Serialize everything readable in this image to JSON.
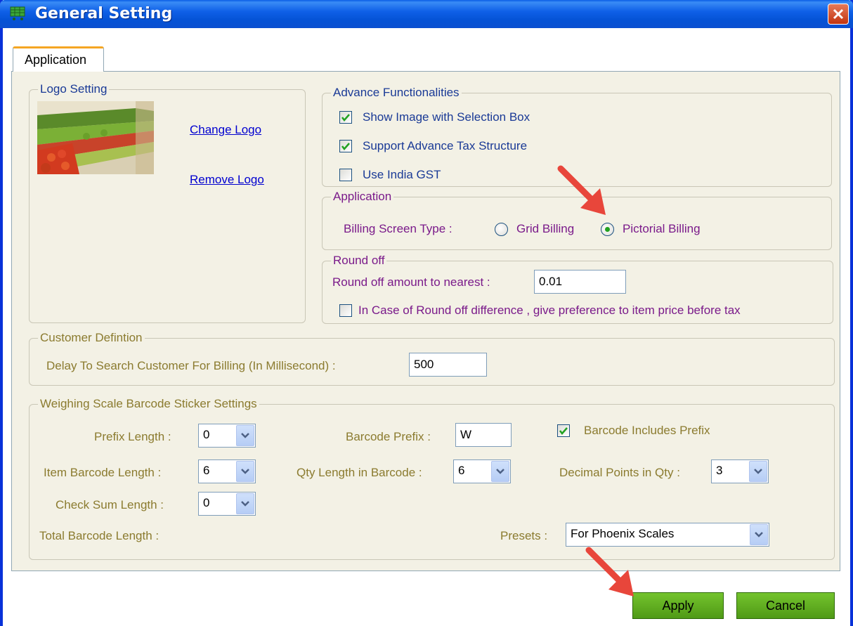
{
  "window": {
    "title": "General Setting"
  },
  "tabs": [
    {
      "label": "Application"
    }
  ],
  "logo_setting": {
    "legend": "Logo Setting",
    "change_logo": "Change Logo",
    "remove_logo": "Remove Logo"
  },
  "advance": {
    "legend": "Advance Functionalities",
    "items": [
      {
        "label": "Show Image with Selection Box",
        "checked": true
      },
      {
        "label": "Support Advance Tax Structure",
        "checked": true
      },
      {
        "label": "Use India GST",
        "checked": false
      }
    ]
  },
  "application": {
    "legend": "Application",
    "billing_label": "Billing Screen Type :",
    "grid_billing": "Grid Billing",
    "pictorial_billing": "Pictorial Billing",
    "selected": "Pictorial Billing"
  },
  "round_off": {
    "legend": "Round off",
    "amount_label": "Round off amount to nearest :",
    "amount_value": "0.01",
    "preference_label": "In Case of Round off difference , give preference to item price before tax",
    "preference_checked": false
  },
  "customer": {
    "legend": "Customer Defintion",
    "delay_label": "Delay To Search Customer For Billing  (In Millisecond) :",
    "delay_value": "500"
  },
  "weighing": {
    "legend": "Weighing Scale Barcode Sticker Settings",
    "prefix_length_label": "Prefix Length :",
    "prefix_length_value": "0",
    "item_barcode_length_label": "Item Barcode Length :",
    "item_barcode_length_value": "6",
    "check_sum_length_label": "Check Sum Length :",
    "check_sum_length_value": "0",
    "total_barcode_length_label": "Total Barcode Length :",
    "barcode_prefix_label": "Barcode Prefix :",
    "barcode_prefix_value": "W",
    "qty_length_label": "Qty Length in Barcode :",
    "qty_length_value": "6",
    "includes_prefix_label": "Barcode Includes Prefix",
    "includes_prefix_checked": true,
    "decimal_points_label": "Decimal Points in Qty :",
    "decimal_points_value": "3",
    "presets_label": "Presets :",
    "presets_value": "For Phoenix Scales"
  },
  "buttons": {
    "apply": "Apply",
    "cancel": "Cancel"
  },
  "colors": {
    "titlebar": "#0a5de6",
    "panel": "#f3f1e5",
    "button_green": "#5fae1f",
    "annotation_arrow": "#e8463b"
  }
}
